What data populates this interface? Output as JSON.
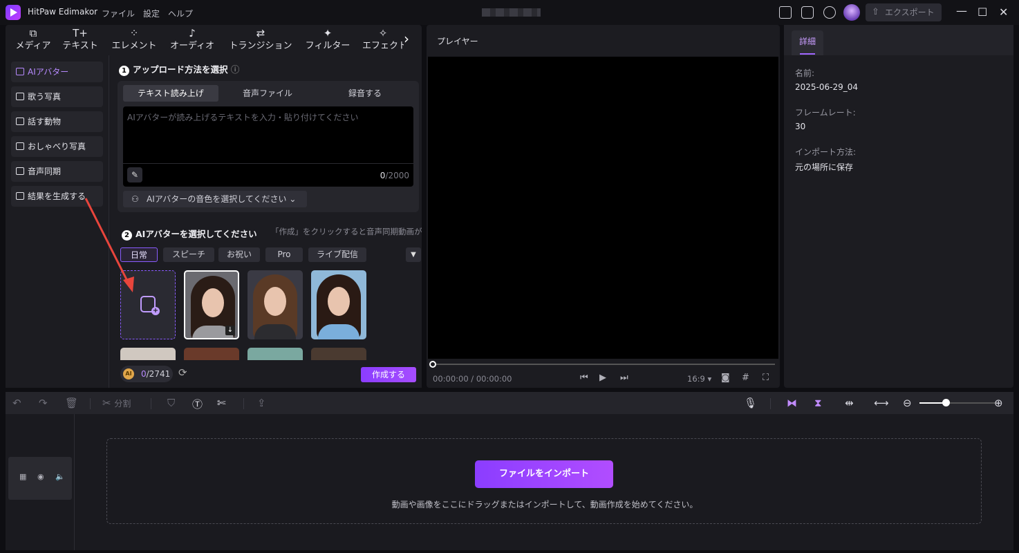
{
  "app": {
    "title": "HitPaw Edimakor",
    "menu": [
      "ファイル",
      "設定",
      "ヘルプ"
    ],
    "export_label": "エクスポート"
  },
  "toolbar": {
    "tabs": [
      "メディア",
      "テキスト",
      "エレメント",
      "オーディオ",
      "トランジション",
      "フィルター",
      "エフェクト"
    ]
  },
  "sidebar": {
    "items": [
      {
        "label": "AIアバター",
        "icon": "ai-avatar-icon",
        "active": true
      },
      {
        "label": "歌う写真",
        "icon": "singing-photo-icon",
        "active": false
      },
      {
        "label": "話す動物",
        "icon": "talking-animal-icon",
        "active": false
      },
      {
        "label": "おしゃべり写真",
        "icon": "talking-photo-icon",
        "active": false
      },
      {
        "label": "音声同期",
        "icon": "lip-sync-icon",
        "active": false
      },
      {
        "label": "結果を生成する",
        "icon": "generate-result-icon",
        "active": false
      }
    ]
  },
  "step1": {
    "number": "1",
    "title": "アップロード方法を選択",
    "tabs": [
      "テキスト読み上げ",
      "音声ファイル",
      "録音する"
    ],
    "active_tab": 0,
    "placeholder": "AIアバターが読み上げるテキストを入力・貼り付けてください",
    "char_current": "0",
    "char_max": "/2000",
    "voice_select": "AIアバターの音色を選択してください"
  },
  "step2": {
    "number": "2",
    "title": "AIアバターを選択してください",
    "hint": "「作成」をクリックすると音声同期動画がで",
    "categories": [
      "日常",
      "スピーチ",
      "お祝い",
      "Pro",
      "ライブ配信"
    ],
    "active_category": 0
  },
  "footer": {
    "credits_used": "0",
    "credits_total": "/2741",
    "create_label": "作成する"
  },
  "player": {
    "title": "プレイヤー",
    "timecode": "00:00:00 / 00:00:00",
    "ratio": "16:9",
    "progress": 0
  },
  "details": {
    "tab": "詳細",
    "fields": [
      {
        "label": "名前:",
        "value": "2025-06-29_04"
      },
      {
        "label": "フレームレート:",
        "value": "30"
      },
      {
        "label": "インポート方法:",
        "value": "元の場所に保存"
      }
    ]
  },
  "timeline": {
    "split_label": "分割",
    "import_label": "ファイルをインポート",
    "drop_hint": "動画や画像をここにドラッグまたはインポートして、動画作成を始めてください。",
    "zoom": 0.35
  },
  "colors": {
    "accent": "#8b3dff",
    "accent_light": "#b78aff",
    "annotation_arrow": "#e8453c"
  }
}
